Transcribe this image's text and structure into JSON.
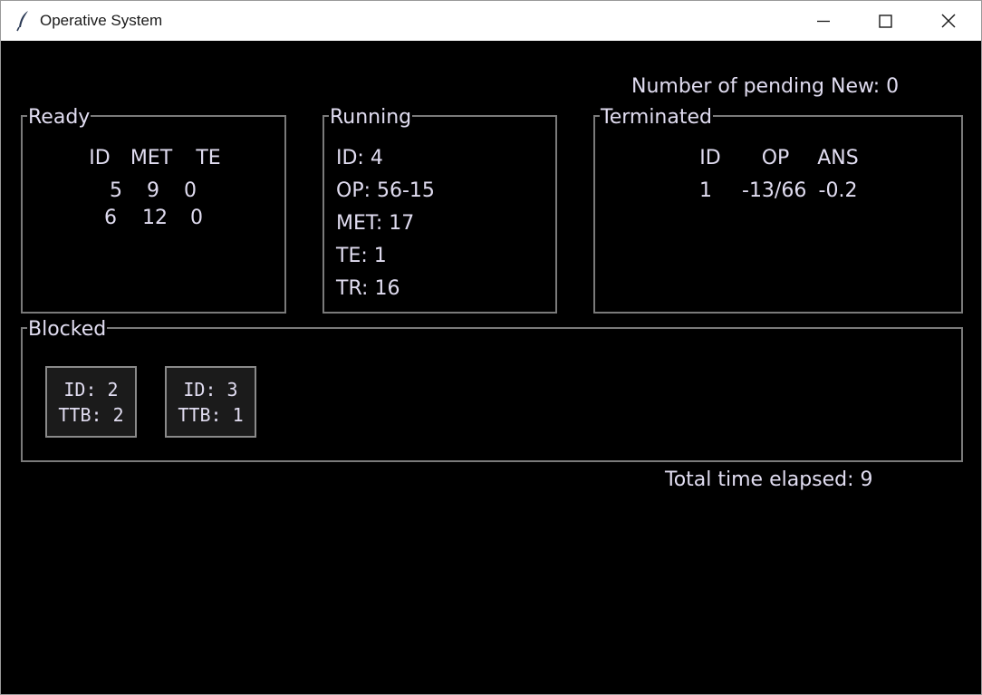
{
  "window": {
    "title": "Operative System"
  },
  "status": {
    "pending_label": "Number of pending New: 0",
    "elapsed_label": "Total time elapsed: 9"
  },
  "ready": {
    "title": "Ready",
    "headers": [
      "ID",
      "MET",
      "TE"
    ],
    "rows": [
      [
        "5",
        "9",
        "0"
      ],
      [
        "6",
        "12",
        "0"
      ]
    ]
  },
  "running": {
    "title": "Running",
    "lines": [
      "ID: 4",
      "OP: 56-15",
      "MET: 17",
      "TE: 1",
      "TR: 16"
    ]
  },
  "terminated": {
    "title": "Terminated",
    "headers": [
      "ID",
      "OP",
      "ANS"
    ],
    "rows": [
      [
        "1",
        "-13/66",
        "-0.2"
      ]
    ]
  },
  "blocked": {
    "title": "Blocked",
    "cards": [
      {
        "id": "ID: 2",
        "ttb": "TTB: 2"
      },
      {
        "id": "ID: 3",
        "ttb": "TTB: 1"
      }
    ]
  },
  "colors": {
    "background": "#000000",
    "text": "#e0dcf0",
    "frame": "#7a7a7a",
    "card_bg": "#1b1b1b"
  }
}
